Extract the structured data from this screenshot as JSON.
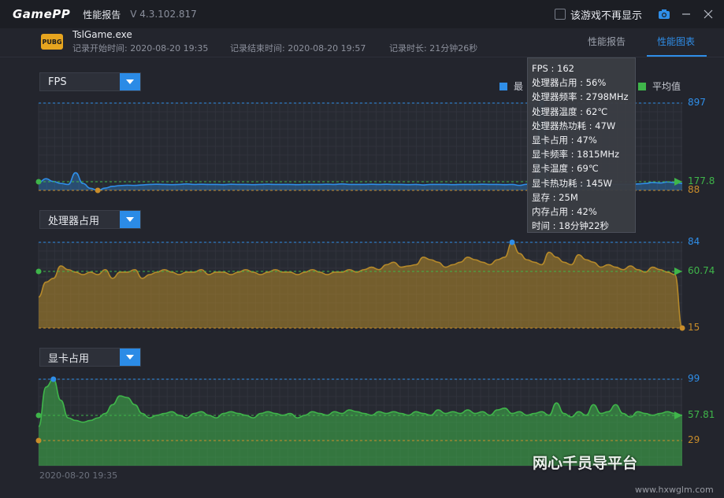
{
  "titlebar": {
    "logo": "GamePP",
    "title": "性能报告",
    "version": "V 4.3.102.817",
    "hide_label": "该游戏不再显示"
  },
  "game": {
    "icon_text": "PUBG",
    "name": "TslGame.exe",
    "start": "记录开始时间: 2020-08-20 19:35",
    "end": "记录结束时间: 2020-08-20 19:57",
    "duration": "记录时长: 21分钟26秒"
  },
  "tabs": [
    {
      "label": "性能报告",
      "active": false
    },
    {
      "label": "性能图表",
      "active": true
    }
  ],
  "legend": {
    "max_label": "最",
    "avg_label": "平均值",
    "max_color": "#2f8ee8",
    "avg_color": "#3fb54a"
  },
  "sections": [
    {
      "dropdown": "FPS",
      "max": "897",
      "avg": "177.8",
      "min": "88",
      "color": "#2f8ee8"
    },
    {
      "dropdown": "处理器占用",
      "max": "84",
      "avg": "60.74",
      "min": "15",
      "color": "#b5892a"
    },
    {
      "dropdown": "显卡占用",
      "max": "99",
      "avg": "57.81",
      "min": "29",
      "color": "#3fb54a"
    }
  ],
  "tooltip": [
    "FPS : 162",
    "处理器占用 : 56%",
    "处理器频率 : 2798MHz",
    "处理器温度 : 62℃",
    "处理器热功耗 : 47W",
    "显卡占用 : 47%",
    "显卡频率 : 1815MHz",
    "显卡温度 : 69℃",
    "显卡热功耗 : 145W",
    "显存 : 25M",
    "内存占用 : 42%",
    "时间 : 18分钟22秒"
  ],
  "footer": {
    "start_date": "2020-08-20 19:35"
  },
  "watermark": {
    "text": "网心千员导平台",
    "sub": "www.hxwglm.com"
  },
  "chart_data": [
    {
      "type": "area",
      "name": "FPS",
      "ylim": [
        88,
        897
      ],
      "max": 897,
      "avg": 177.8,
      "min": 88,
      "values": [
        170,
        205,
        180,
        160,
        150,
        260,
        160,
        110,
        88,
        112,
        130,
        138,
        142,
        140,
        145,
        150,
        152,
        150,
        148,
        150,
        155,
        150,
        152,
        150,
        150,
        148,
        152,
        150,
        150,
        148,
        150,
        152,
        150,
        150,
        150,
        148,
        150,
        150,
        150,
        152,
        150,
        155,
        150,
        150,
        150,
        152,
        150,
        152,
        150,
        150,
        148,
        150,
        145,
        150,
        150,
        150,
        148,
        150,
        150,
        150,
        152,
        150,
        150,
        148,
        150,
        140,
        152,
        150,
        897,
        200,
        150,
        160,
        150,
        150,
        155,
        148,
        150,
        152,
        150,
        150,
        150,
        155,
        160,
        170,
        165,
        175,
        170,
        160
      ]
    },
    {
      "type": "area",
      "name": "处理器占用",
      "ylim": [
        15,
        84
      ],
      "max": 84,
      "avg": 60.74,
      "min": 15,
      "values": [
        40,
        52,
        55,
        65,
        62,
        60,
        58,
        60,
        58,
        62,
        55,
        60,
        60,
        62,
        55,
        58,
        60,
        62,
        60,
        58,
        60,
        60,
        62,
        58,
        60,
        60,
        58,
        60,
        62,
        60,
        58,
        60,
        62,
        60,
        60,
        58,
        60,
        62,
        60,
        58,
        60,
        60,
        62,
        60,
        62,
        64,
        62,
        66,
        68,
        64,
        65,
        66,
        72,
        70,
        68,
        64,
        66,
        68,
        72,
        70,
        68,
        66,
        70,
        72,
        84,
        75,
        70,
        68,
        66,
        76,
        72,
        68,
        66,
        74,
        70,
        68,
        64,
        66,
        64,
        62,
        65,
        62,
        60,
        64,
        62,
        60,
        58,
        15
      ]
    },
    {
      "type": "area",
      "name": "显卡占用",
      "ylim": [
        29,
        99
      ],
      "max": 99,
      "avg": 57.81,
      "min": 29,
      "values": [
        45,
        90,
        99,
        75,
        55,
        52,
        50,
        52,
        55,
        60,
        70,
        80,
        78,
        70,
        60,
        55,
        58,
        60,
        62,
        58,
        55,
        60,
        62,
        58,
        55,
        60,
        62,
        60,
        58,
        55,
        60,
        62,
        60,
        58,
        60,
        55,
        58,
        62,
        60,
        58,
        62,
        60,
        64,
        62,
        60,
        58,
        62,
        60,
        62,
        60,
        58,
        62,
        60,
        58,
        64,
        60,
        62,
        60,
        64,
        60,
        62,
        58,
        64,
        66,
        60,
        62,
        58,
        60,
        62,
        58,
        72,
        60,
        56,
        62,
        58,
        70,
        60,
        62,
        70,
        60,
        56,
        62,
        60,
        58,
        60,
        62,
        60,
        58
      ]
    }
  ]
}
